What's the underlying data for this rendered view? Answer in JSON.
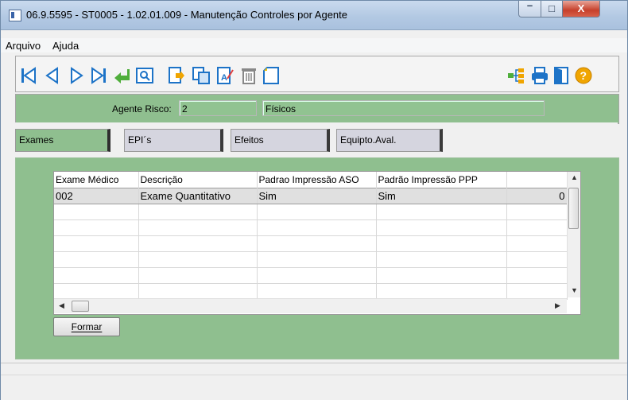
{
  "window": {
    "title": "06.9.5595 - ST0005 - 1.02.01.009 - Manutenção Controles por Agente",
    "minimize_label": "–",
    "maximize_label": "□",
    "close_label": "X"
  },
  "menu": {
    "items": [
      {
        "label": "Arquivo"
      },
      {
        "label": "Ajuda"
      }
    ]
  },
  "toolbar": {
    "icons": [
      "first-record-icon",
      "previous-record-icon",
      "next-record-icon",
      "last-record-icon",
      "confirm-icon",
      "search-icon",
      "export-icon",
      "copy-icon",
      "edit-icon",
      "delete-icon",
      "new-record-icon",
      "tree-icon",
      "print-icon",
      "exit-icon",
      "help-icon"
    ],
    "accent": "#1d73c7"
  },
  "agent": {
    "label": "Agente Risco:",
    "code": "2",
    "name": "Físicos"
  },
  "tabs": [
    {
      "label": "Exames",
      "active": true
    },
    {
      "label": "EPI´s",
      "active": false
    },
    {
      "label": "Efeitos",
      "active": false
    },
    {
      "label": "Equipto.Aval.",
      "active": false
    }
  ],
  "grid": {
    "columns": [
      "Exame Médico",
      "Descrição",
      "Padrao Impressão ASO",
      "Padrão Impressão PPP",
      ""
    ],
    "rows": [
      [
        "002",
        "Exame Quantitativo",
        "Sim",
        "Sim",
        "0"
      ],
      [
        "",
        "",
        "",
        "",
        ""
      ],
      [
        "",
        "",
        "",
        "",
        ""
      ],
      [
        "",
        "",
        "",
        "",
        ""
      ],
      [
        "",
        "",
        "",
        "",
        ""
      ],
      [
        "",
        "",
        "",
        "",
        ""
      ],
      [
        "",
        "",
        "",
        "",
        ""
      ]
    ]
  },
  "buttons": {
    "formar": "Formar"
  },
  "colors": {
    "panel_green": "#8fbf8f",
    "tab_inactive": "#d5d5df"
  }
}
